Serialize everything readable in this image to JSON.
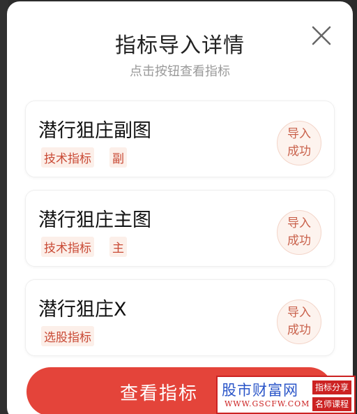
{
  "modal": {
    "title": "指标导入详情",
    "subtitle": "点击按钮查看指标",
    "close_icon": "close-icon"
  },
  "indicators": [
    {
      "name": "潜行狙庄副图",
      "tags": [
        "技术指标",
        "副"
      ],
      "status_line1": "导入",
      "status_line2": "成功"
    },
    {
      "name": "潜行狙庄主图",
      "tags": [
        "技术指标",
        "主"
      ],
      "status_line1": "导入",
      "status_line2": "成功"
    },
    {
      "name": "潜行狙庄X",
      "tags": [
        "选股指标"
      ],
      "status_line1": "导入",
      "status_line2": "成功"
    }
  ],
  "cta": {
    "label": "查看指标"
  },
  "watermark": {
    "site_name": "股市财富网",
    "url": "WWW.GSCFW.COM",
    "tag1": "指标分享",
    "tag2": "名师课程"
  },
  "colors": {
    "accent": "#e4443a",
    "tag_text": "#c94a35",
    "tag_bg": "#fcefe9",
    "status_text": "#c9624c",
    "title": "#222222",
    "subtitle": "#9a9a9a"
  }
}
